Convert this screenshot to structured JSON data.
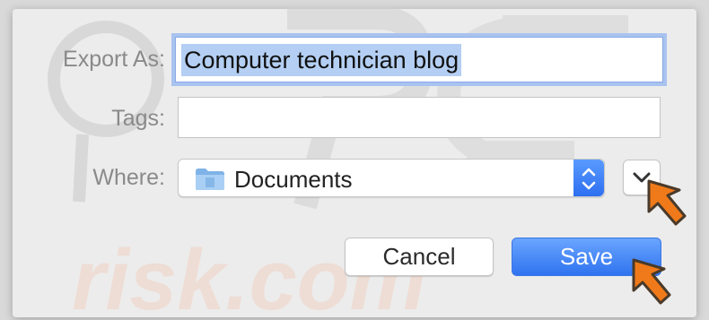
{
  "form": {
    "export_as_label": "Export As:",
    "export_as_value": "Computer technician blog",
    "tags_label": "Tags:",
    "tags_value": "",
    "where_label": "Where:",
    "where_value": "Documents"
  },
  "buttons": {
    "cancel_label": "Cancel",
    "save_label": "Save"
  },
  "watermark": {
    "text": "risk.com"
  },
  "icons": {
    "folder": "folder-icon",
    "stepper": "up-down-stepper-icon",
    "expand": "chevron-down-icon",
    "pointer": "orange-arrow-pointer"
  },
  "colors": {
    "accent": "#2f73ef",
    "selection": "#b4cff3",
    "pointer": "#f07a1a"
  }
}
